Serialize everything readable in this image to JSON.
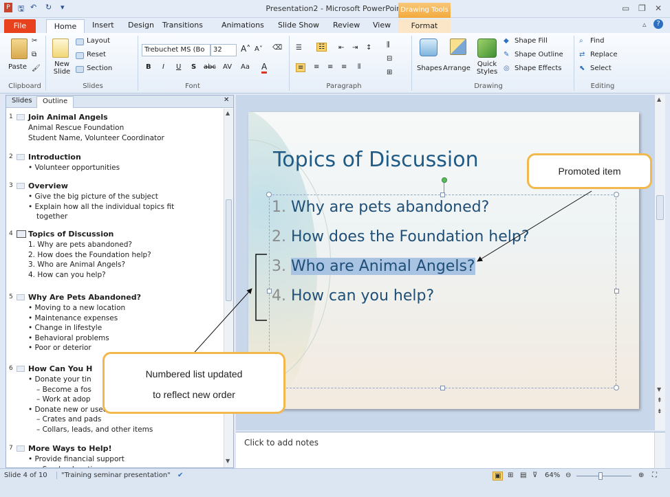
{
  "window": {
    "title": "Presentation2 - Microsoft PowerPoint",
    "contextual_tab_group": "Drawing Tools"
  },
  "tabs": [
    "File",
    "Home",
    "Insert",
    "Design",
    "Transitions",
    "Animations",
    "Slide Show",
    "Review",
    "View",
    "Format"
  ],
  "ribbon": {
    "clipboard": {
      "paste": "Paste",
      "label": "Clipboard"
    },
    "slides": {
      "new_slide": "New Slide",
      "layout": "Layout",
      "reset": "Reset",
      "section": "Section",
      "label": "Slides"
    },
    "font": {
      "font_name": "Trebuchet MS (Bo",
      "font_size": "32",
      "label": "Font"
    },
    "paragraph": {
      "label": "Paragraph"
    },
    "drawing": {
      "shapes": "Shapes",
      "arrange": "Arrange",
      "quick_styles": "Quick Styles",
      "shape_fill": "Shape Fill",
      "shape_outline": "Shape Outline",
      "shape_effects": "Shape Effects",
      "label": "Drawing"
    },
    "editing": {
      "find": "Find",
      "replace": "Replace",
      "select": "Select",
      "label": "Editing"
    }
  },
  "panel": {
    "tab_slides": "Slides",
    "tab_outline": "Outline",
    "slides": [
      {
        "num": "1",
        "title": "Join Animal Angels",
        "lines": [
          "Animal Rescue Foundation",
          "Student Name, Volunteer Coordinator"
        ]
      },
      {
        "num": "2",
        "title": "Introduction",
        "lines": [
          "• Volunteer opportunities"
        ]
      },
      {
        "num": "3",
        "title": "Overview",
        "lines": [
          "• Give the big picture of the subject",
          "• Explain how all the individual topics fit",
          "together"
        ]
      },
      {
        "num": "4",
        "title": "Topics of Discussion",
        "lines": [
          "1. Why are pets abandoned?",
          "2. How does the Foundation help?",
          "3. Who are Animal Angels?",
          "4. How can you help?"
        ]
      },
      {
        "num": "5",
        "title": "Why Are Pets Abandoned?",
        "lines": [
          "• Moving to a new location",
          "• Maintenance expenses",
          "• Change in lifestyle",
          "• Behavioral problems",
          "• Poor or deterior"
        ]
      },
      {
        "num": "6",
        "title": "How Can You H",
        "lines": [
          "• Donate your tin",
          "– Become a fos",
          "– Work at adop",
          "• Donate new or used items",
          "– Crates and pads",
          "– Collars, leads, and other items"
        ]
      },
      {
        "num": "7",
        "title": "More Ways to Help!",
        "lines": [
          "• Provide financial support",
          "– Send a donation"
        ]
      }
    ]
  },
  "slide": {
    "title": "Topics of Discussion",
    "items": [
      {
        "n": "1.",
        "text": "Why are pets abandoned?"
      },
      {
        "n": "2.",
        "text": "How does the Foundation help?"
      },
      {
        "n": "3.",
        "text": "Who are Animal Angels?"
      },
      {
        "n": "4.",
        "text": "How can you help?"
      }
    ]
  },
  "notes_placeholder": "Click to add notes",
  "status": {
    "slide_info": "Slide 4 of 10",
    "theme": "\"Training seminar presentation\"",
    "zoom": "64%"
  },
  "callouts": {
    "promoted": "Promoted item",
    "numbered_line1": "Numbered list updated",
    "numbered_line2": "to reflect new order"
  }
}
